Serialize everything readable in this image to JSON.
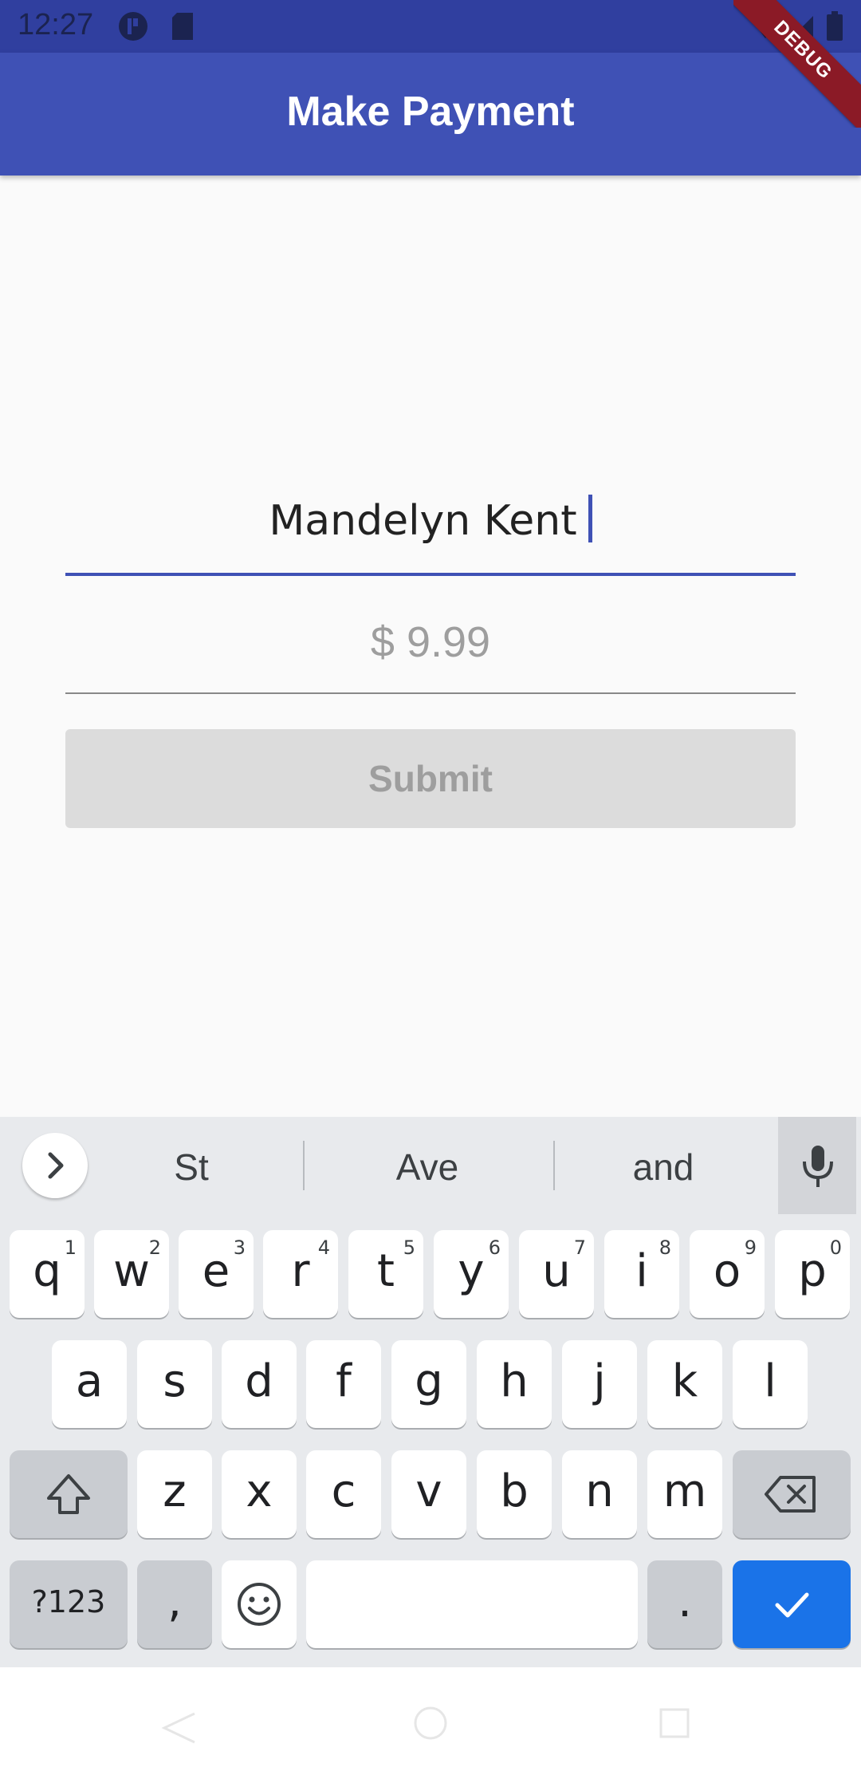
{
  "status_bar": {
    "time": "12:27"
  },
  "app_bar": {
    "title": "Make Payment",
    "debug_label": "DEBUG"
  },
  "form": {
    "name_value": "Mandelyn Kent",
    "amount_value": "$ 9.99",
    "submit_label": "Submit"
  },
  "keyboard": {
    "suggestions": [
      "St",
      "Ave",
      "and"
    ],
    "row1": [
      {
        "key": "q",
        "hint": "1"
      },
      {
        "key": "w",
        "hint": "2"
      },
      {
        "key": "e",
        "hint": "3"
      },
      {
        "key": "r",
        "hint": "4"
      },
      {
        "key": "t",
        "hint": "5"
      },
      {
        "key": "y",
        "hint": "6"
      },
      {
        "key": "u",
        "hint": "7"
      },
      {
        "key": "i",
        "hint": "8"
      },
      {
        "key": "o",
        "hint": "9"
      },
      {
        "key": "p",
        "hint": "0"
      }
    ],
    "row2": [
      "a",
      "s",
      "d",
      "f",
      "g",
      "h",
      "j",
      "k",
      "l"
    ],
    "row3": [
      "z",
      "x",
      "c",
      "v",
      "b",
      "n",
      "m"
    ],
    "symbols_label": "?123",
    "comma_label": ",",
    "period_label": "."
  },
  "colors": {
    "primary": "#3f51b5",
    "status_bar": "#303f9f",
    "enter_key": "#1a73e8",
    "debug_banner": "#8b1a26"
  },
  "icons": [
    "sim-card-icon",
    "wifi-icon",
    "signal-icon",
    "battery-icon",
    "chevron-right-icon",
    "mic-icon",
    "shift-icon",
    "backspace-icon",
    "emoji-icon",
    "check-icon",
    "back-icon",
    "home-icon",
    "recents-icon"
  ]
}
